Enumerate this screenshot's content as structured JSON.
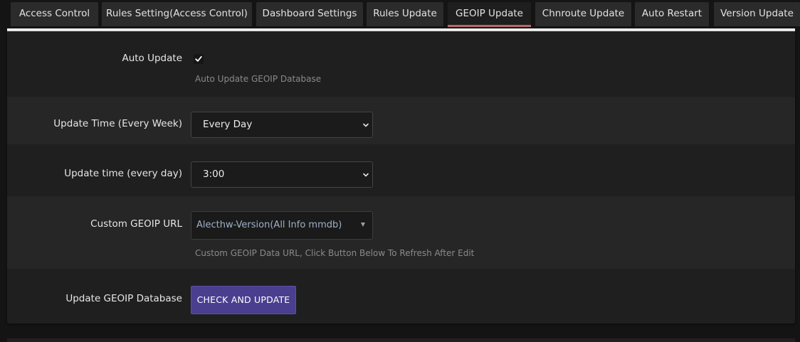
{
  "tabs": [
    {
      "label": "Access Control"
    },
    {
      "label": "Rules Setting(Access Control)"
    },
    {
      "label": "Dashboard Settings"
    },
    {
      "label": "Rules Update"
    },
    {
      "label": "GEOIP Update"
    },
    {
      "label": "Chnroute Update"
    },
    {
      "label": "Auto Restart"
    },
    {
      "label": "Version Update"
    }
  ],
  "active_tab": "GEOIP Update",
  "form": {
    "auto_update": {
      "label": "Auto Update",
      "checked": true,
      "hint": "Auto Update GEOIP Database"
    },
    "update_time_week": {
      "label": "Update Time (Every Week)",
      "value": "Every Day"
    },
    "update_time_day": {
      "label": "Update time (every day)",
      "value": "3:00"
    },
    "custom_url": {
      "label": "Custom GEOIP URL",
      "value": "Alecthw-Version(All Info mmdb)",
      "hint": "Custom GEOIP Data URL, Click Button Below To Refresh After Edit"
    },
    "update_db": {
      "label": "Update GEOIP Database",
      "button": "CHECK AND UPDATE"
    }
  },
  "colors": {
    "accent_tab": "#b8686a",
    "button_bg": "#4a3f8f"
  }
}
